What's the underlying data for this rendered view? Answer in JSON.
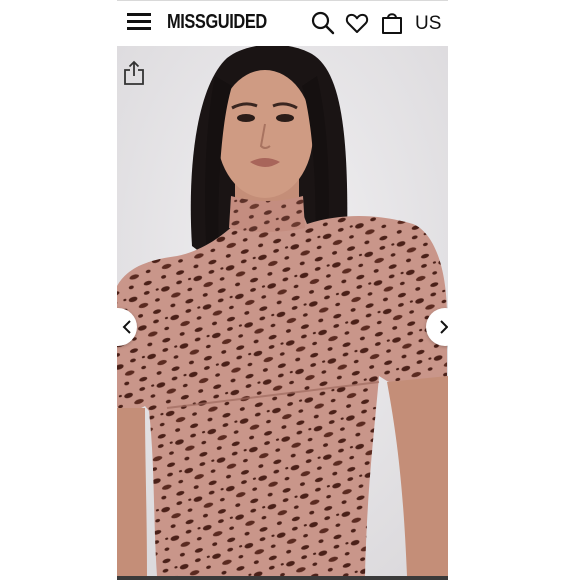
{
  "header": {
    "brand": "MISSGUIDED",
    "region": "US",
    "icons": [
      "menu-icon",
      "search-icon",
      "heart-icon",
      "bag-icon"
    ]
  },
  "gallery": {
    "icons": [
      "share-icon",
      "chevron-left-icon",
      "chevron-right-icon"
    ],
    "image_description_colors": {
      "dress": "#c9968a",
      "spots": "#4a2018",
      "background": "#e9e8ea"
    }
  }
}
